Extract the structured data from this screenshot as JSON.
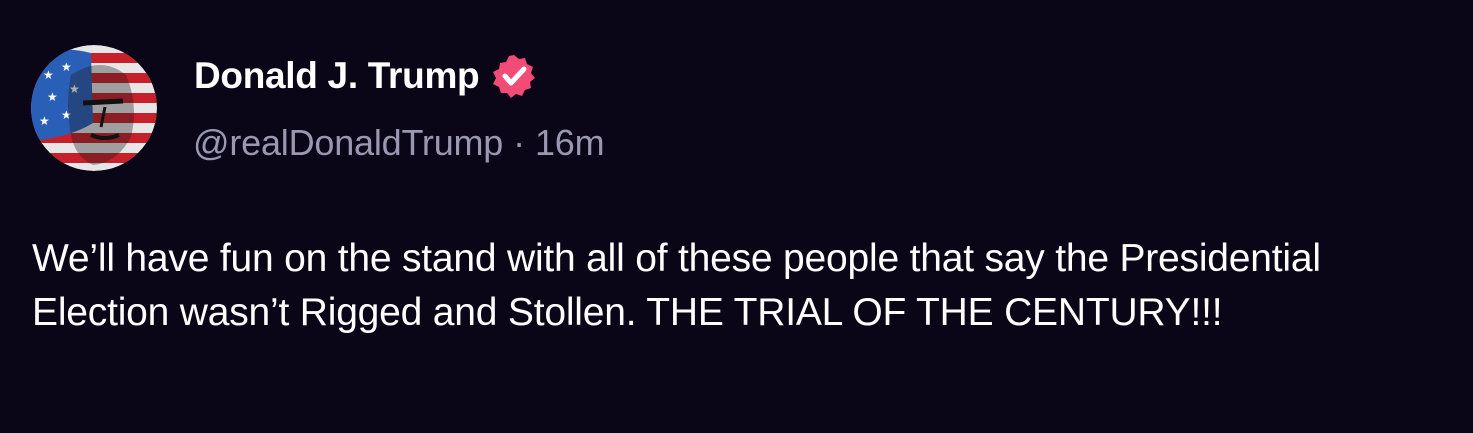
{
  "author": {
    "display_name": "Donald J. Trump",
    "handle": "@realDonaldTrump",
    "separator": "·",
    "timestamp": "16m",
    "verified": true,
    "avatar_icon": "profile-avatar"
  },
  "post": {
    "text": "We’ll have fun on the stand with all of these people that say the Presidential Election wasn’t Rigged and Stollen. THE TRIAL OF THE CENTURY!!!"
  },
  "colors": {
    "background": "#0a0618",
    "text": "#ffffff",
    "muted_text": "#9a98b0",
    "verified_badge": "#f24b75"
  }
}
